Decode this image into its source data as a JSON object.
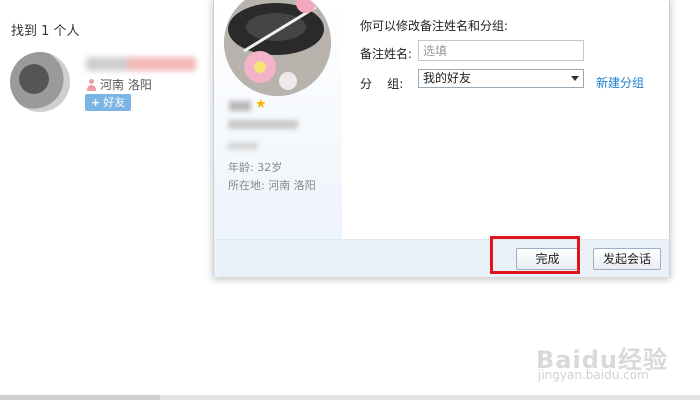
{
  "search": {
    "result_title": "找到 1 个人",
    "result_location": "河南 洛阳",
    "add_friend_label": "好友",
    "add_friend_icon": "plus-icon"
  },
  "dialog": {
    "profile": {
      "age_text": "年龄: 32岁",
      "location_text": "所在地: 河南  洛阳"
    },
    "form": {
      "hint": "你可以修改备注姓名和分组:",
      "remark_label": "备注姓名:",
      "remark_placeholder": "选填",
      "remark_value": "",
      "group_label": "分    组:",
      "group_selected": "我的好友",
      "new_group_link": "新建分组"
    },
    "buttons": {
      "done": "完成",
      "start_chat": "发起会话"
    }
  },
  "colors": {
    "accent_link": "#1e7fd0",
    "highlight_border": "#e0141b",
    "add_button_bg": "#7cb4e4",
    "footer_bg": "#eaf1f8"
  },
  "watermark": {
    "logo": "Baidu经验",
    "url": "jingyan.baidu.com"
  }
}
